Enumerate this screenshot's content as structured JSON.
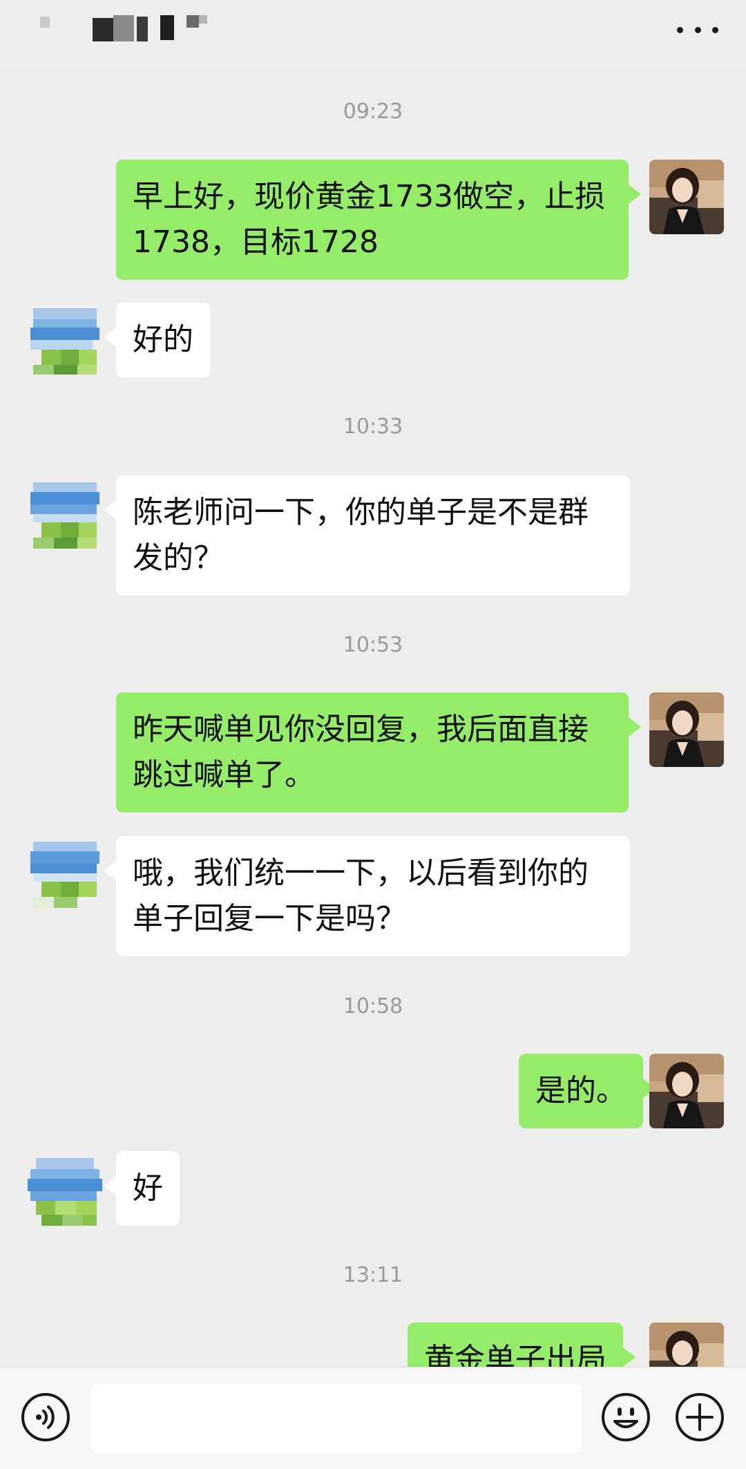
{
  "header": {
    "more_icon": "more-dots-icon"
  },
  "messages": [
    {
      "type": "timestamp",
      "text": "09:23"
    },
    {
      "type": "self",
      "text": "早上好，现价黄金1733做空，止损1738，目标1728"
    },
    {
      "type": "peer",
      "text": "好的"
    },
    {
      "type": "timestamp",
      "text": "10:33"
    },
    {
      "type": "peer",
      "text": "陈老师问一下，你的单子是不是群发的？"
    },
    {
      "type": "timestamp",
      "text": "10:53"
    },
    {
      "type": "self",
      "text": "昨天喊单见你没回复，我后面直接跳过喊单了。"
    },
    {
      "type": "peer",
      "text": "哦，我们统一一下，以后看到你的单子回复一下是吗？"
    },
    {
      "type": "timestamp",
      "text": "10:58"
    },
    {
      "type": "self",
      "text": "是的。"
    },
    {
      "type": "peer",
      "text": "好"
    },
    {
      "type": "timestamp",
      "text": "13:11"
    },
    {
      "type": "self",
      "text": "黄金单子出局"
    }
  ],
  "input_bar": {
    "voice_icon": "voice-icon",
    "emoji_icon": "emoji-icon",
    "plus_icon": "plus-icon",
    "input_value": ""
  }
}
